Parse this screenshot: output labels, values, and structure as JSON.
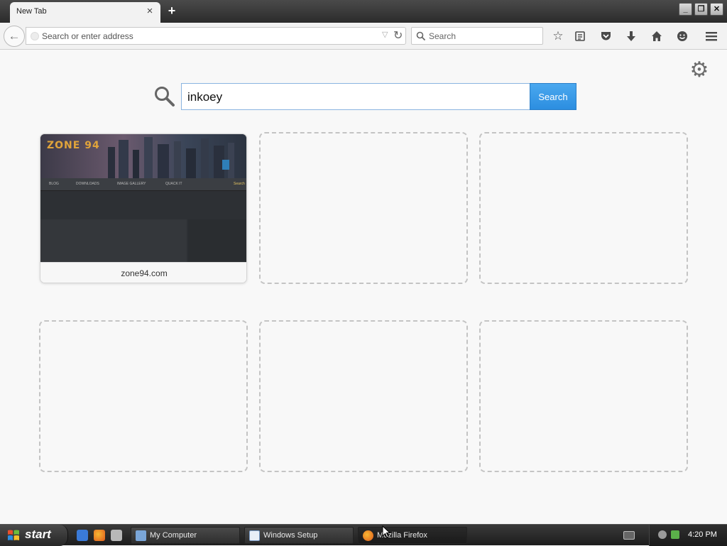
{
  "tab": {
    "title": "New Tab",
    "close_glyph": "×",
    "new_tab_glyph": "+"
  },
  "window_controls": {
    "minimize": "_",
    "restore": "❐",
    "close": "✕"
  },
  "navbar": {
    "back_glyph": "←",
    "url_placeholder": "Search or enter address",
    "reload_glyph": "↻",
    "dropdown_glyph": "▽",
    "search_placeholder": "Search",
    "icons": [
      "star-icon",
      "reading-list-icon",
      "pocket-icon",
      "download-icon",
      "home-icon",
      "hello-icon",
      "menu-icon"
    ]
  },
  "content": {
    "search_query": "inkoey",
    "search_button": "Search",
    "tiles": [
      {
        "label": "zone94.com",
        "thumb_logo": "ZONE 94",
        "thumb_menu": [
          "BLOG",
          "DOWNLOADS",
          "IMAGE GALLERY",
          "QUACK IT",
          "Search"
        ]
      }
    ]
  },
  "taskbar": {
    "start_label": "start",
    "tasks": [
      {
        "label": "My Computer"
      },
      {
        "label": "Windows Setup"
      },
      {
        "label": "Mozilla Firefox"
      }
    ],
    "clock": "4:20 PM"
  },
  "colors": {
    "accent": "#2c8ee0",
    "taskbar": "#1c1c1c"
  }
}
